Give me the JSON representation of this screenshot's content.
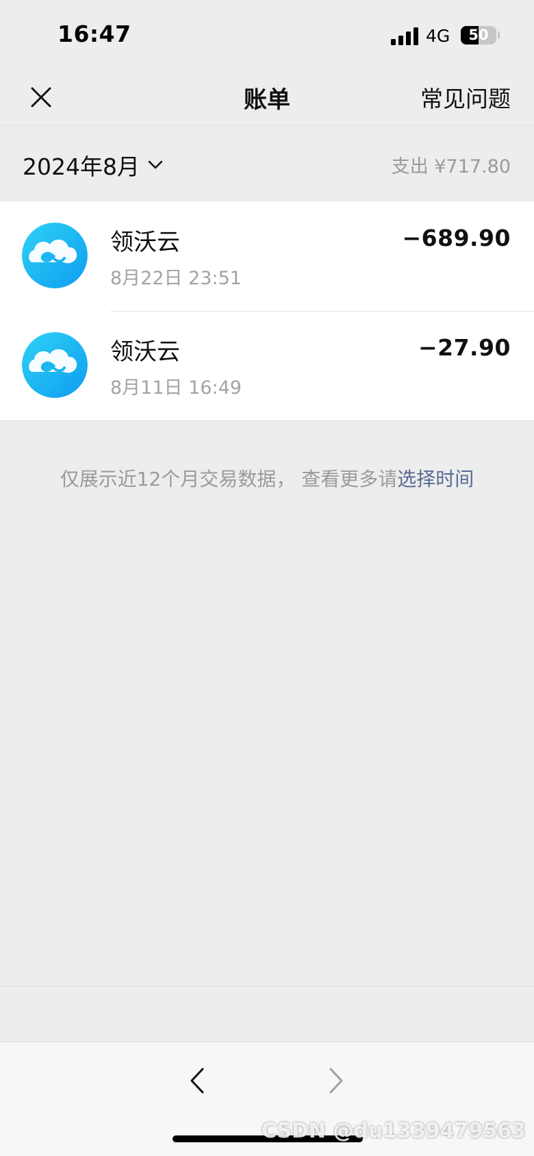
{
  "status_bar": {
    "time": "16:47",
    "network": "4G",
    "battery_level": 50,
    "battery_text": "50"
  },
  "nav": {
    "title": "账单",
    "faq_label": "常见问题",
    "close_icon": "close-icon"
  },
  "summary": {
    "month_label": "2024年8月",
    "spend_label": "支出 ¥717.80"
  },
  "transactions": [
    {
      "merchant": "领沃云",
      "time": "8月22日 23:51",
      "amount": "−689.90",
      "icon": "cloud-logo-icon"
    },
    {
      "merchant": "领沃云",
      "time": "8月11日 16:49",
      "amount": "−27.90",
      "icon": "cloud-logo-icon"
    }
  ],
  "notice": {
    "text": "仅展示近12个月交易数据， 查看更多请",
    "link": "选择时间"
  },
  "watermark": "CSDN @du1339479563",
  "colors": {
    "brand_cyan": "#17b9f2",
    "link_blue": "#576b95",
    "muted_gray": "#9a9a9a",
    "page_bg": "#ededed"
  }
}
